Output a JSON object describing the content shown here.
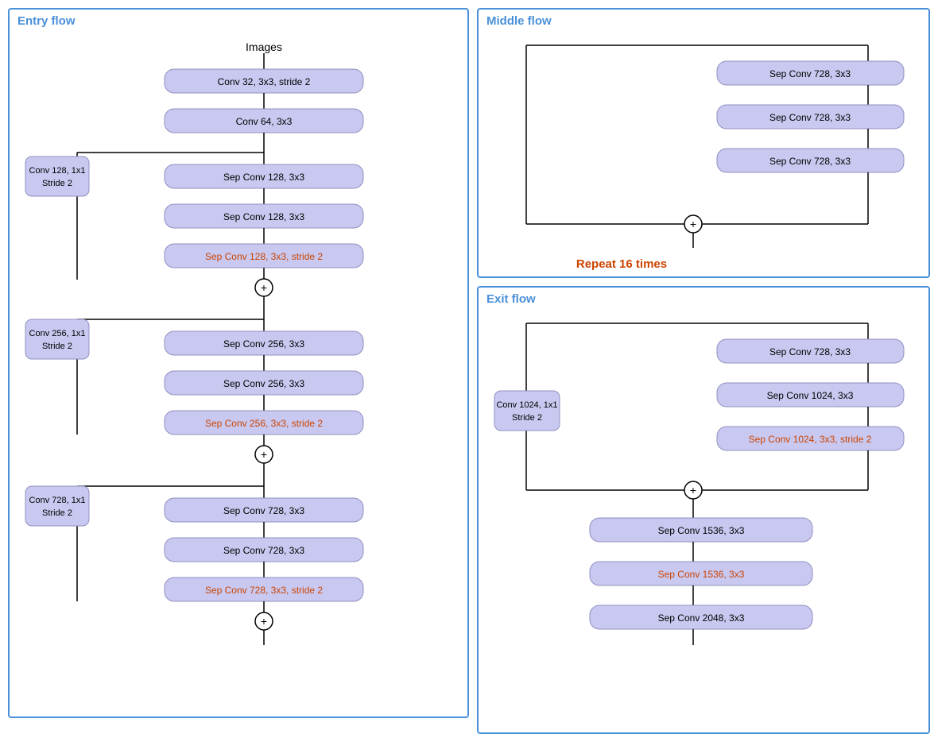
{
  "entry_flow": {
    "title": "Entry  flow",
    "header_label": "Images",
    "nodes": {
      "conv32": "Conv 32, 3x3, stride 2",
      "conv64": "Conv 64, 3x3",
      "side1": "Conv 128, 1x1\nStride 2",
      "sep128a": "Sep Conv 128, 3x3",
      "sep128b": "Sep Conv 128, 3x3",
      "sep128c": "Sep Conv 128, 3x3, stride 2",
      "side2": "Conv 256, 1x1\nStride 2",
      "sep256a": "Sep Conv 256, 3x3",
      "sep256b": "Sep Conv 256, 3x3",
      "sep256c": "Sep Conv 256, 3x3, stride 2",
      "side3": "Conv 728, 1x1\nStride 2",
      "sep728a": "Sep Conv 728, 3x3",
      "sep728b": "Sep Conv 728, 3x3",
      "sep728c": "Sep Conv 728, 3x3, stride 2"
    }
  },
  "middle_flow": {
    "title": "Middle  flow",
    "nodes": {
      "sep728a": "Sep Conv 728, 3x3",
      "sep728b": "Sep Conv 728, 3x3",
      "sep728c": "Sep Conv 728, 3x3"
    },
    "repeat_label": "Repeat 16 times"
  },
  "exit_flow": {
    "title": "Exit  flow",
    "nodes": {
      "side": "Conv 1024, 1x1\nStride 2",
      "sep728": "Sep Conv 728, 3x3",
      "sep1024": "Sep Conv 1024, 3x3",
      "sep1024s": "Sep Conv 1024, 3x3, stride 2",
      "sep1536a": "Sep Conv 1536, 3x3",
      "sep1536b": "Sep Conv 1536, 3x3",
      "sep2048": "Sep Conv 2048, 3x3"
    }
  }
}
